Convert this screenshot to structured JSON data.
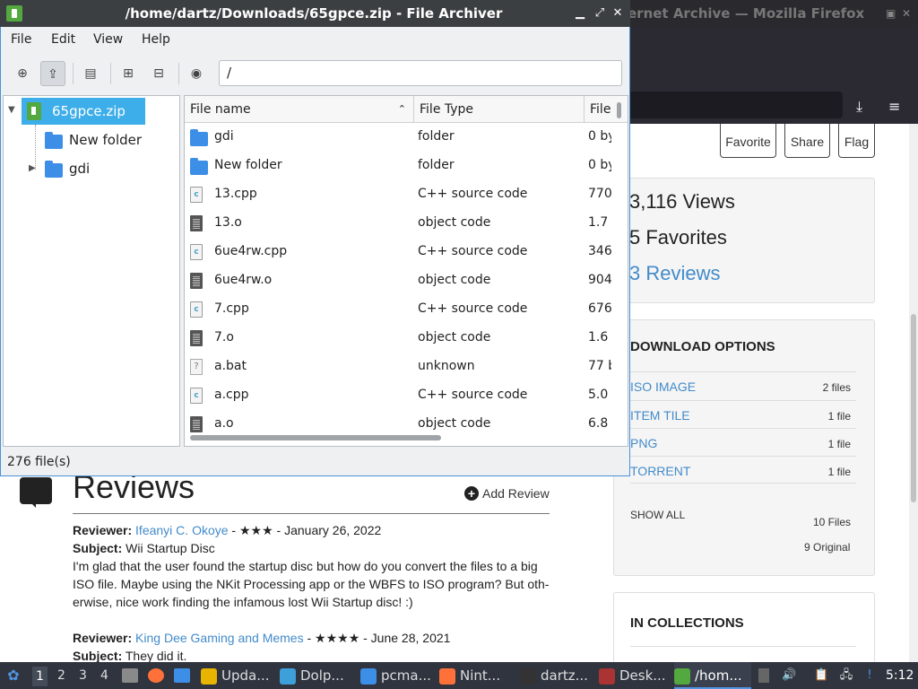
{
  "firefox": {
    "window_title": "ernet Archive — Mozilla Firefox",
    "buttons": {
      "favorite": "Favorite",
      "share": "Share",
      "flag": "Flag"
    },
    "stats": {
      "views": "3,116 Views",
      "favorites": "5 Favorites",
      "reviews": "3 Reviews"
    },
    "download_options": {
      "heading": "DOWNLOAD OPTIONS",
      "rows": [
        {
          "label": "ISO IMAGE",
          "count": "2 files"
        },
        {
          "label": "ITEM TILE",
          "count": "1 file"
        },
        {
          "label": "PNG",
          "count": "1 file"
        },
        {
          "label": "TORRENT",
          "count": "1 file"
        }
      ],
      "show_all": "SHOW ALL",
      "total_files": "10 Files",
      "original": "9 Original"
    },
    "collections_heading": "IN COLLECTIONS",
    "reviews": {
      "title": "Reviews",
      "add_review": "Add Review",
      "items": [
        {
          "reviewer_label": "Reviewer:",
          "reviewer": "Ifeanyi C. Okoye",
          "meta": " - ★★★ - January 26, 2022",
          "subject_label": "Subject:",
          "subject": " Wii Startup Disc",
          "body_lines": [
            "I'm glad that the user found the startup disc but how do you convert the files to a big",
            "ISO file. Maybe using the NKit Processing app or the WBFS to ISO program? But oth-",
            "erwise, nice work finding the infamous lost Wii Startup disc! :)"
          ]
        },
        {
          "reviewer_label": "Reviewer:",
          "reviewer": "King Dee Gaming and Memes",
          "meta": " - ★★★★ - June 28, 2021",
          "subject_label": "Subject:",
          "subject": " They did it."
        }
      ]
    }
  },
  "archiver": {
    "title": "/home/dartz/Downloads/65gpce.zip - File Archiver",
    "menu": [
      "File",
      "Edit",
      "View",
      "Help"
    ],
    "location": "/",
    "tree": [
      {
        "label": "65gpce.zip"
      },
      {
        "label": "New folder"
      },
      {
        "label": "gdi"
      }
    ],
    "columns": [
      "File name",
      "File Type",
      "File"
    ],
    "files": [
      {
        "name": "gdi",
        "type": "folder",
        "size": "0 by",
        "icon": "folder"
      },
      {
        "name": "New folder",
        "type": "folder",
        "size": "0 by",
        "icon": "folder"
      },
      {
        "name": "13.cpp",
        "type": "C++ source code",
        "size": "770",
        "icon": "cpp"
      },
      {
        "name": "13.o",
        "type": "object code",
        "size": "1.7",
        "icon": "obj"
      },
      {
        "name": "6ue4rw.cpp",
        "type": "C++ source code",
        "size": "346",
        "icon": "cpp"
      },
      {
        "name": "6ue4rw.o",
        "type": "object code",
        "size": "904",
        "icon": "obj"
      },
      {
        "name": "7.cpp",
        "type": "C++ source code",
        "size": "676",
        "icon": "cpp"
      },
      {
        "name": "7.o",
        "type": "object code",
        "size": "1.6",
        "icon": "obj"
      },
      {
        "name": "a.bat",
        "type": "unknown",
        "size": "77 b",
        "icon": "unknown"
      },
      {
        "name": "a.cpp",
        "type": "C++ source code",
        "size": "5.0",
        "icon": "cpp"
      },
      {
        "name": "a.o",
        "type": "object code",
        "size": "6.8",
        "icon": "obj"
      }
    ],
    "status": "276 file(s)"
  },
  "taskbar": {
    "workspaces": [
      "1",
      "2",
      "3",
      "4"
    ],
    "tasks": [
      {
        "label": "Upda...",
        "color": "#e8b400"
      },
      {
        "label": "Dolp...",
        "color": "#3da0d8"
      },
      {
        "label": "pcma...",
        "color": "#3d8ee6"
      },
      {
        "label": "Nint...",
        "color": "#ff7139"
      },
      {
        "label": "dartz...",
        "color": "#333333"
      },
      {
        "label": "Desk...",
        "color": "#a33"
      },
      {
        "label": "/hom...",
        "color": "#53a93f"
      }
    ],
    "clock": "5:12"
  },
  "colors": {
    "accent": "#3daee9",
    "link": "#428bca",
    "titlebar": "#3c3f41",
    "panel": "#2f343f"
  }
}
